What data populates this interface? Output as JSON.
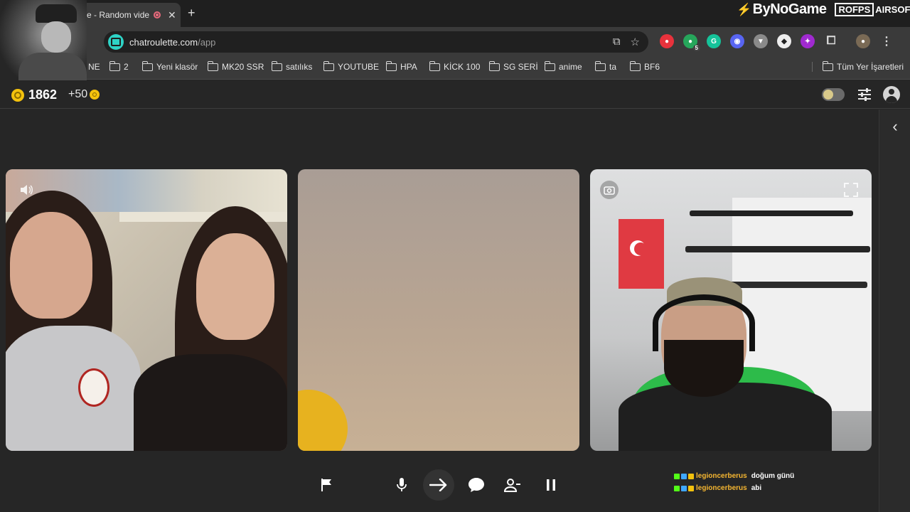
{
  "browser": {
    "tab_title": "e - Random vide",
    "url_host": "chatroulette.com",
    "url_path": "/app",
    "bookmarks": [
      {
        "label": "NE"
      },
      {
        "label": "2"
      },
      {
        "label": "Yeni klasör"
      },
      {
        "label": "MK20 SSR"
      },
      {
        "label": "satılıks"
      },
      {
        "label": "YOUTUBE"
      },
      {
        "label": "HPA"
      },
      {
        "label": "KİCK 100"
      },
      {
        "label": "SG SERİ"
      },
      {
        "label": "anime"
      },
      {
        "label": "ta"
      },
      {
        "label": "BF6"
      }
    ],
    "all_bookmarks_label": "Tüm Yer İşaretleri",
    "extension_badge": "5"
  },
  "overlay": {
    "brand": "ByNoGame",
    "brand2_box": "ROFPS",
    "brand2_text": "AIRSOFT"
  },
  "app": {
    "coins": "1862",
    "coin_bonus": "+50"
  },
  "chat": {
    "messages": [
      {
        "user": "legioncerberus",
        "text": "doğum günü"
      },
      {
        "user": "legioncerberus",
        "text": "abi"
      }
    ]
  },
  "colors": {
    "accent": "#2ed3c6",
    "coin": "#f4c20d",
    "username": "#f7b731"
  }
}
